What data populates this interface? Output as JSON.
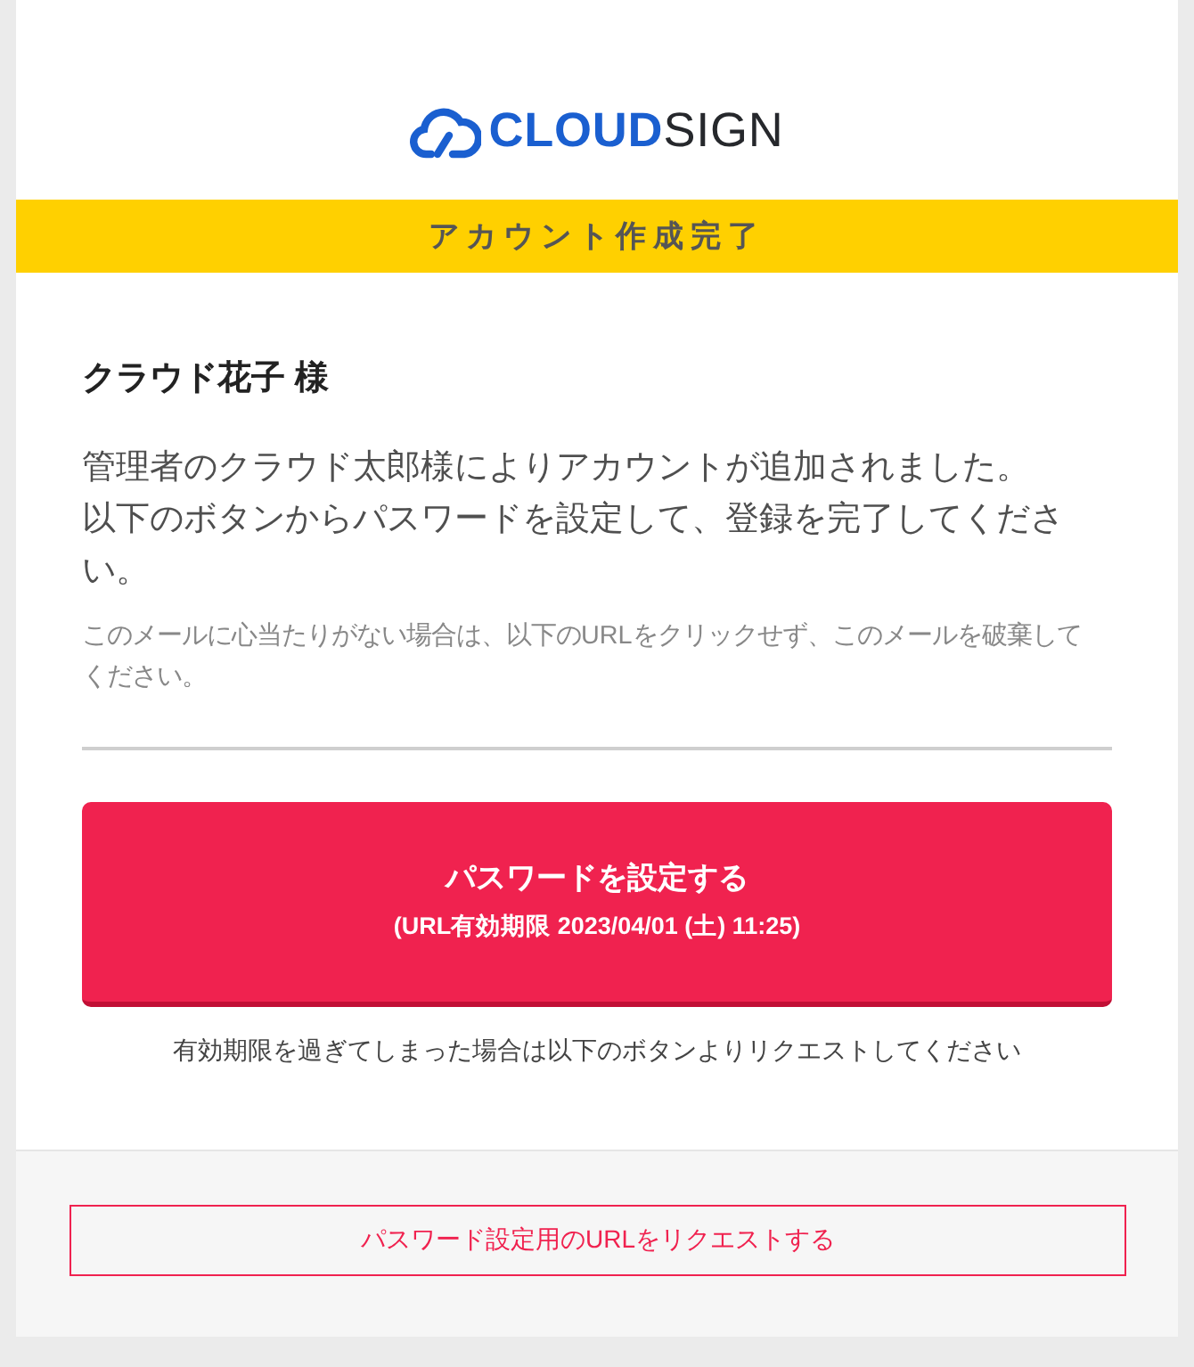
{
  "logo": {
    "text_primary": "CLOUD",
    "text_secondary": "SIGN"
  },
  "banner": {
    "title": "アカウント作成完了"
  },
  "content": {
    "recipient": "クラウド花子 様",
    "message": [
      "管理者のクラウド太郎様によりアカウントが追加されました。",
      "以下のボタンからパスワードを設定して、登録を完了してください。"
    ],
    "notice": "このメールに心当たりがない場合は、以下のURLをクリックせず、このメールを破棄してください。",
    "primary_button": {
      "label": "パスワードを設定する",
      "expiry": "(URL有効期限 2023/04/01 (土) 11:25)"
    },
    "expired_note": "有効期限を過ぎてしまった場合は以下のボタンよりリクエストしてください"
  },
  "footer": {
    "request_button": {
      "label": "パスワード設定用のURLをリクエストする"
    }
  }
}
